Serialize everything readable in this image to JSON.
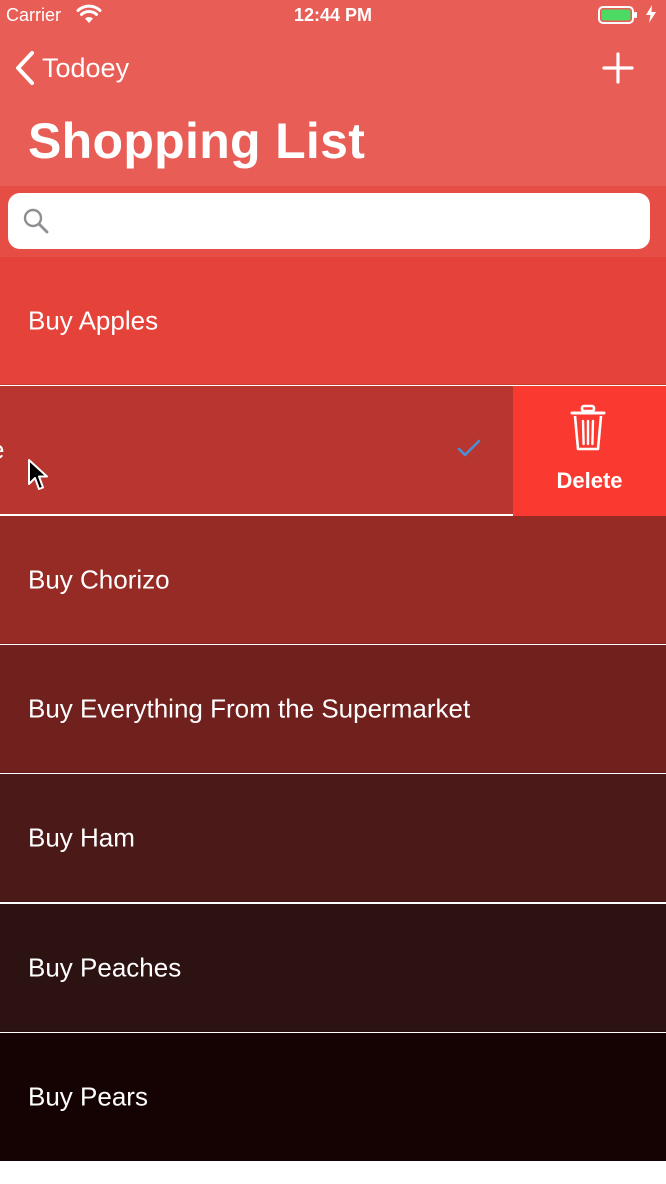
{
  "status_bar": {
    "carrier": "Carrier",
    "time": "12:44 PM"
  },
  "nav": {
    "back_label": "Todoey",
    "add_icon": "plus-icon"
  },
  "page": {
    "title": "Shopping List"
  },
  "search": {
    "placeholder": "",
    "value": "",
    "icon": "search-icon"
  },
  "rows": [
    {
      "label": "Buy Apples",
      "color": "#e54239",
      "checked": false
    },
    {
      "label": "se",
      "color": "#b8362f",
      "checked": true,
      "swiped": true
    },
    {
      "label": "Buy Chorizo",
      "color": "#962b26",
      "checked": false
    },
    {
      "label": "Buy Everything From the Supermarket",
      "color": "#70201d",
      "checked": false
    },
    {
      "label": "Buy Ham",
      "color": "#4b1a18",
      "checked": false
    },
    {
      "label": "Buy Peaches",
      "color": "#2c1211",
      "checked": false
    },
    {
      "label": "Buy Pears",
      "color": "#150304",
      "checked": false
    }
  ],
  "swipe_action": {
    "label": "Delete",
    "icon": "trash-icon",
    "color": "#fa3a30"
  },
  "colors": {
    "nav_bar": "#e85d55",
    "search_bar": "#e64d45",
    "checkmark": "#4a90d9"
  }
}
